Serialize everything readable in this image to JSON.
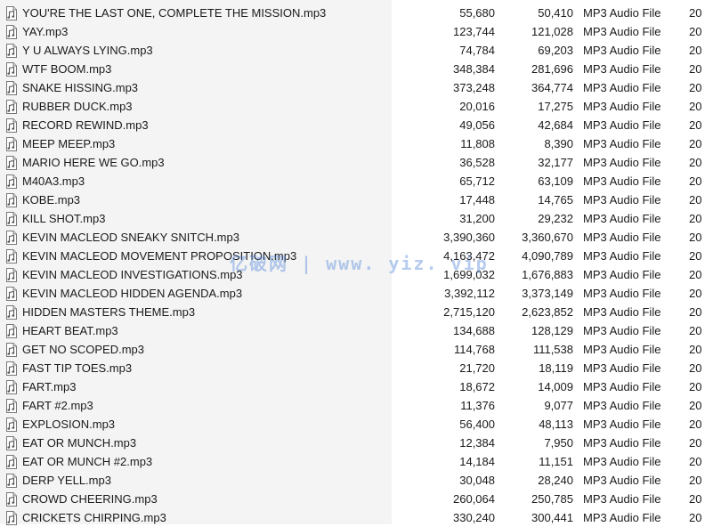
{
  "watermark": "亿破网 | www. yiz. vip",
  "rows": [
    {
      "name": "YOU'RE THE LAST ONE, COMPLETE THE MISSION.mp3",
      "size": "55,680",
      "compressed": "50,410",
      "type": "MP3 Audio File",
      "date": "20"
    },
    {
      "name": "YAY.mp3",
      "size": "123,744",
      "compressed": "121,028",
      "type": "MP3 Audio File",
      "date": "20"
    },
    {
      "name": "Y U ALWAYS LYING.mp3",
      "size": "74,784",
      "compressed": "69,203",
      "type": "MP3 Audio File",
      "date": "20"
    },
    {
      "name": "WTF BOOM.mp3",
      "size": "348,384",
      "compressed": "281,696",
      "type": "MP3 Audio File",
      "date": "20"
    },
    {
      "name": "SNAKE HISSING.mp3",
      "size": "373,248",
      "compressed": "364,774",
      "type": "MP3 Audio File",
      "date": "20"
    },
    {
      "name": "RUBBER DUCK.mp3",
      "size": "20,016",
      "compressed": "17,275",
      "type": "MP3 Audio File",
      "date": "20"
    },
    {
      "name": "RECORD REWIND.mp3",
      "size": "49,056",
      "compressed": "42,684",
      "type": "MP3 Audio File",
      "date": "20"
    },
    {
      "name": "MEEP MEEP.mp3",
      "size": "11,808",
      "compressed": "8,390",
      "type": "MP3 Audio File",
      "date": "20"
    },
    {
      "name": "MARIO HERE WE GO.mp3",
      "size": "36,528",
      "compressed": "32,177",
      "type": "MP3 Audio File",
      "date": "20"
    },
    {
      "name": "M40A3.mp3",
      "size": "65,712",
      "compressed": "63,109",
      "type": "MP3 Audio File",
      "date": "20"
    },
    {
      "name": "KOBE.mp3",
      "size": "17,448",
      "compressed": "14,765",
      "type": "MP3 Audio File",
      "date": "20"
    },
    {
      "name": "KILL SHOT.mp3",
      "size": "31,200",
      "compressed": "29,232",
      "type": "MP3 Audio File",
      "date": "20"
    },
    {
      "name": "KEVIN MACLEOD SNEAKY SNITCH.mp3",
      "size": "3,390,360",
      "compressed": "3,360,670",
      "type": "MP3 Audio File",
      "date": "20"
    },
    {
      "name": "KEVIN MACLEOD MOVEMENT PROPOSITION.mp3",
      "size": "4,163,472",
      "compressed": "4,090,789",
      "type": "MP3 Audio File",
      "date": "20"
    },
    {
      "name": "KEVIN MACLEOD INVESTIGATIONS.mp3",
      "size": "1,699,032",
      "compressed": "1,676,883",
      "type": "MP3 Audio File",
      "date": "20"
    },
    {
      "name": "KEVIN MACLEOD HIDDEN AGENDA.mp3",
      "size": "3,392,112",
      "compressed": "3,373,149",
      "type": "MP3 Audio File",
      "date": "20"
    },
    {
      "name": "HIDDEN MASTERS THEME.mp3",
      "size": "2,715,120",
      "compressed": "2,623,852",
      "type": "MP3 Audio File",
      "date": "20"
    },
    {
      "name": "HEART BEAT.mp3",
      "size": "134,688",
      "compressed": "128,129",
      "type": "MP3 Audio File",
      "date": "20"
    },
    {
      "name": "GET NO SCOPED.mp3",
      "size": "114,768",
      "compressed": "111,538",
      "type": "MP3 Audio File",
      "date": "20"
    },
    {
      "name": "FAST TIP TOES.mp3",
      "size": "21,720",
      "compressed": "18,119",
      "type": "MP3 Audio File",
      "date": "20"
    },
    {
      "name": "FART.mp3",
      "size": "18,672",
      "compressed": "14,009",
      "type": "MP3 Audio File",
      "date": "20"
    },
    {
      "name": "FART #2.mp3",
      "size": "11,376",
      "compressed": "9,077",
      "type": "MP3 Audio File",
      "date": "20"
    },
    {
      "name": "EXPLOSION.mp3",
      "size": "56,400",
      "compressed": "48,113",
      "type": "MP3 Audio File",
      "date": "20"
    },
    {
      "name": "EAT OR MUNCH.mp3",
      "size": "12,384",
      "compressed": "7,950",
      "type": "MP3 Audio File",
      "date": "20"
    },
    {
      "name": "EAT OR MUNCH #2.mp3",
      "size": "14,184",
      "compressed": "11,151",
      "type": "MP3 Audio File",
      "date": "20"
    },
    {
      "name": "DERP YELL.mp3",
      "size": "30,048",
      "compressed": "28,240",
      "type": "MP3 Audio File",
      "date": "20"
    },
    {
      "name": "CROWD CHEERING.mp3",
      "size": "260,064",
      "compressed": "250,785",
      "type": "MP3 Audio File",
      "date": "20"
    },
    {
      "name": "CRICKETS CHIRPING.mp3",
      "size": "330,240",
      "compressed": "300,441",
      "type": "MP3 Audio File",
      "date": "20"
    }
  ]
}
